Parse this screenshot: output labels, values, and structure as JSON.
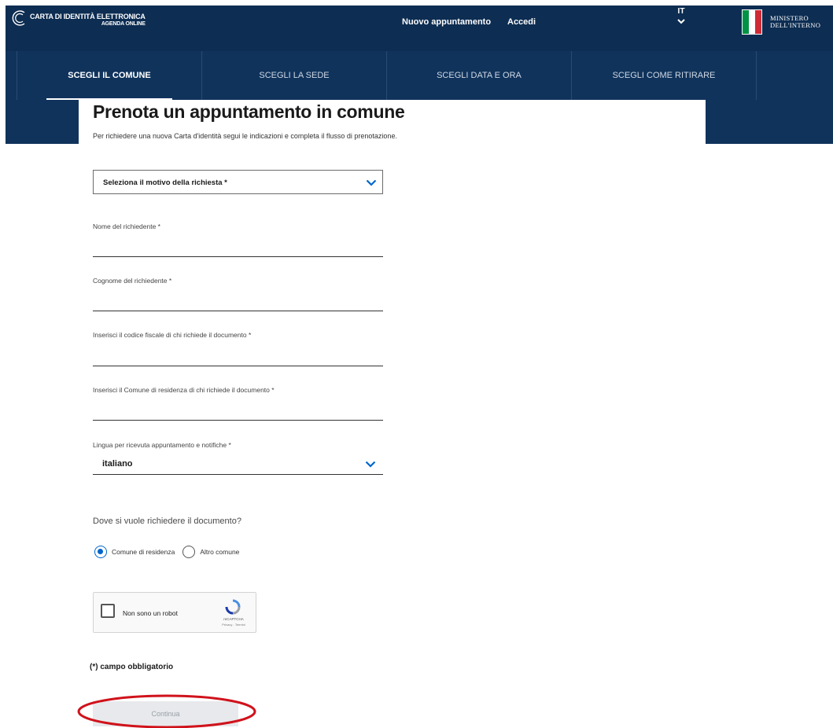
{
  "header": {
    "brand_title": "CARTA DI IDENTITÀ ELETTRONICA",
    "brand_sub": "AGENDA ONLINE",
    "new_appointment": "Nuovo appuntamento",
    "login": "Accedi",
    "language": "IT",
    "ministry_line1": "MINISTERO",
    "ministry_line2": "DELL'INTERNO"
  },
  "steps": [
    {
      "label": "SCEGLI IL COMUNE",
      "active": true
    },
    {
      "label": "SCEGLI LA SEDE",
      "active": false
    },
    {
      "label": "SCEGLI DATA E ORA",
      "active": false
    },
    {
      "label": "SCEGLI COME RITIRARE",
      "active": false
    }
  ],
  "form": {
    "title": "Prenota un appuntamento in comune",
    "subtitle": "Per richiedere una nuova Carta d'identità segui le indicazioni e completa il flusso di prenotazione.",
    "reason_select": "Seleziona il motivo della richiesta *",
    "name_label": "Nome del richiedente *",
    "surname_label": "Cognome del richiedente *",
    "fiscal_code_label": "Inserisci il codice fiscale di chi richiede il documento *",
    "residence_label": "Inserisci il Comune di residenza di chi richiede il documento *",
    "language_label": "Lingua per ricevuta appuntamento e notifiche *",
    "language_value": "italiano",
    "where_question": "Dove si vuole richiedere il documento?",
    "option_residence": "Comune di residenza",
    "option_other": "Altro comune",
    "selected_option": "Comune di residenza",
    "required_note": "(*) campo obbligatorio",
    "continue_label": "Continua"
  },
  "captcha": {
    "label": "Non sono un robot",
    "brand": "reCAPTCHA",
    "links": "Privacy - Termini"
  },
  "colors": {
    "header_bg": "#0d2d52",
    "nav_bg": "#10335c",
    "radio_selected": "#0066cc",
    "annotation": "#d0121b"
  },
  "icons": {
    "brand_logo": "cie-logo-icon",
    "chevron": "chevron-down-icon",
    "flag": "italian-flag-icon",
    "captcha": "recaptcha-icon"
  }
}
